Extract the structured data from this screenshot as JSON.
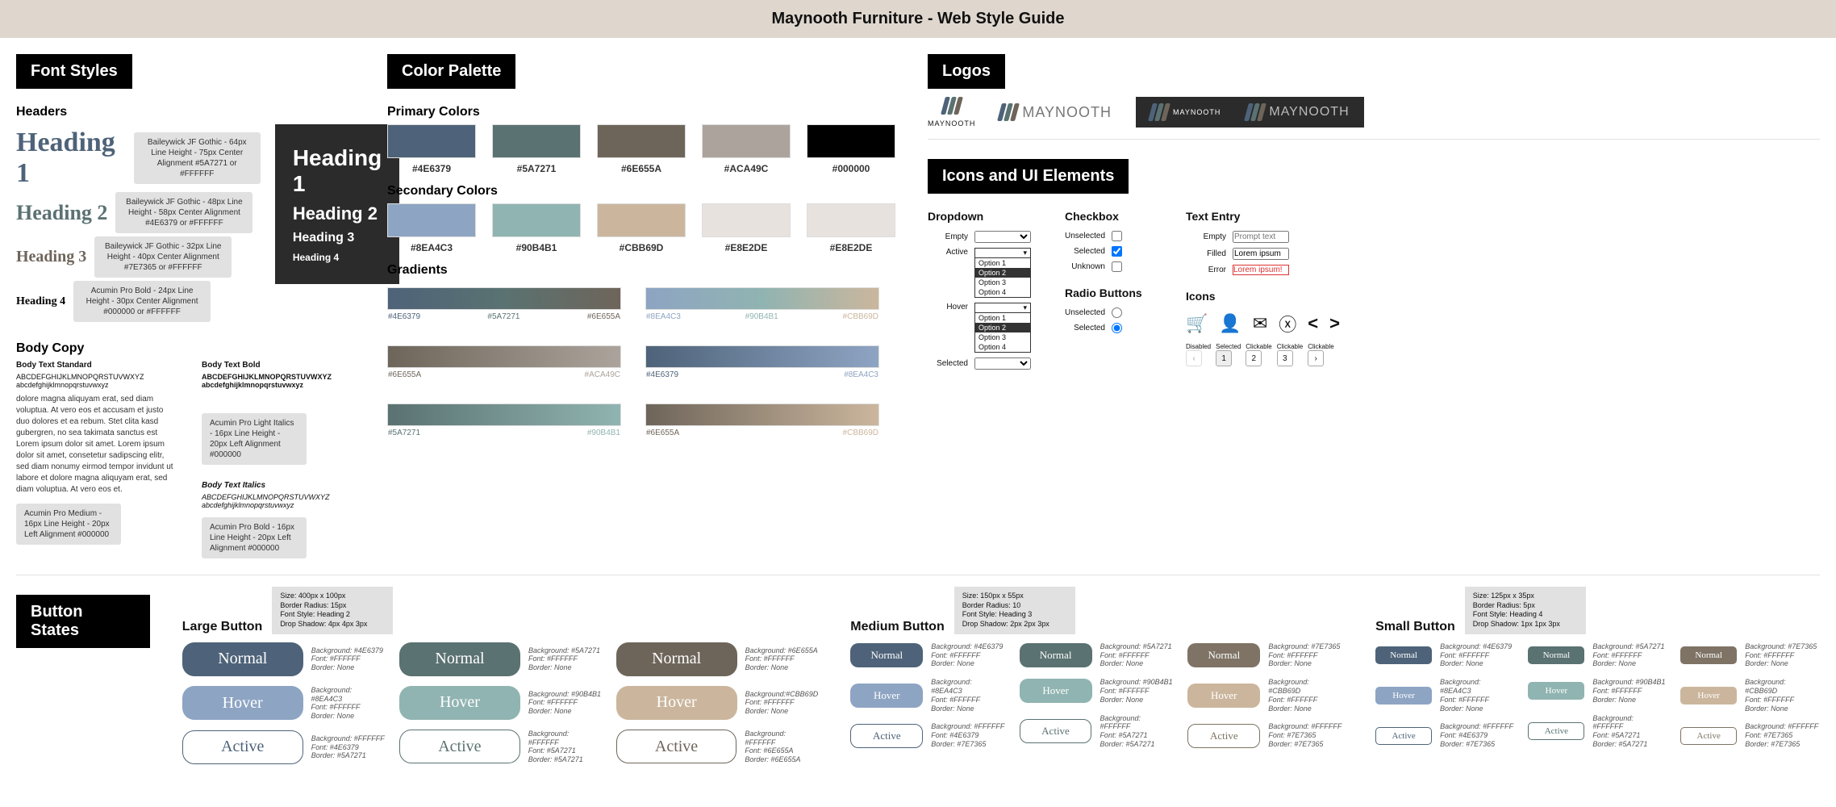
{
  "banner": "Maynooth Furniture - Web Style Guide",
  "sections": {
    "fontStyles": "Font Styles",
    "colorPalette": "Color Palette",
    "logos": "Logos",
    "iconsUI": "Icons and UI Elements",
    "buttonStates": "Button States"
  },
  "fontStyles": {
    "headersLabel": "Headers",
    "bodyCopyLabel": "Body Copy",
    "headings": [
      {
        "label": "Heading 1",
        "annot": "Baileywick JF Gothic - 64px\nLine Height - 75px\nCenter Alignment\n#5A7271 or #FFFFFF"
      },
      {
        "label": "Heading 2",
        "annot": "Baileywick JF Gothic - 48px\nLine Height - 58px\nCenter Alignment\n#4E6379 or #FFFFFF"
      },
      {
        "label": "Heading 3",
        "annot": "Baileywick JF Gothic - 32px\nLine Height - 40px\nCenter Alignment\n#7E7365 or #FFFFFF"
      },
      {
        "label": "Heading 4",
        "annot": "Acumin Pro Bold - 24px\nLine Height - 30px\nCenter Alignment\n#000000 or #FFFFFF"
      }
    ],
    "body": {
      "standardTitle": "Body Text Standard",
      "standardSample": "ABCDEFGHIJKLMNOPQRSTUVWXYZ\nabcdefghijklmnopqrstuvwxyz",
      "lorem": "dolore magna aliquyam erat, sed diam voluptua. At vero eos et accusam et justo duo dolores et ea rebum. Stet clita kasd gubergren, no sea takimata sanctus est Lorem ipsum dolor sit amet. Lorem ipsum dolor sit amet, consetetur sadipscing elitr, sed diam nonumy eirmod tempor invidunt ut labore et dolore magna aliquyam erat, sed diam voluptua. At vero eos et.",
      "standardAnnot": "Acumin Pro Medium - 16px\nLine Height - 20px\nLeft Alignment\n#000000",
      "boldTitle": "Body Text Bold",
      "boldSample": "ABCDEFGHIJKLMNOPQRSTUVWXYZ\nabcdefghijklmnopqrstuvwxyz",
      "boldAnnot": "Acumin Pro Light Italics - 16px\nLine Height - 20px\nLeft Alignment\n#000000",
      "italicTitle": "Body Text Italics",
      "italicSample": "ABCDEFGHIJKLMNOPQRSTUVWXYZ\nabcdefghijklmnopqrstuvwxyz",
      "italicAnnot": "Acumin Pro Bold - 16px\nLine Height - 20px\nLeft Alignment\n#000000"
    }
  },
  "colors": {
    "primaryLabel": "Primary Colors",
    "secondaryLabel": "Secondary Colors",
    "gradientsLabel": "Gradients",
    "primary": [
      {
        "hex": "#4E6379"
      },
      {
        "hex": "#5A7271"
      },
      {
        "hex": "#6E655A"
      },
      {
        "hex": "#ACA49C"
      },
      {
        "hex": "#000000"
      }
    ],
    "secondary": [
      {
        "hex": "#8EA4C3"
      },
      {
        "hex": "#90B4B1"
      },
      {
        "hex": "#CBB69D"
      },
      {
        "hex": "#E8E2DE"
      },
      {
        "hex": "#E8E2DE"
      }
    ],
    "gradients": [
      {
        "stops": [
          "#4E6379",
          "#5A7271",
          "#6E655A"
        ]
      },
      {
        "stops": [
          "#8EA4C3",
          "#90B4B1",
          "#CBB69D"
        ]
      },
      {
        "stops": [
          "#6E655A",
          "#ACA49C"
        ]
      },
      {
        "stops": [
          "#4E6379",
          "#8EA4C3"
        ]
      },
      {
        "stops": [
          "#5A7271",
          "#90B4B1"
        ]
      },
      {
        "stops": [
          "#6E655A",
          "#CBB69D"
        ]
      }
    ]
  },
  "logos": {
    "brand": "MAYNOOTH"
  },
  "iconsUI": {
    "dropdown": {
      "title": "Dropdown",
      "states": [
        "Empty",
        "Active",
        "Hover",
        "Selected"
      ],
      "options": [
        "Option 1",
        "Option 2",
        "Option 3",
        "Option 4"
      ]
    },
    "checkbox": {
      "title": "Checkbox",
      "states": [
        "Unselected",
        "Selected",
        "Unknown"
      ]
    },
    "radio": {
      "title": "Radio Buttons",
      "states": [
        "Unselected",
        "Selected"
      ]
    },
    "textEntry": {
      "title": "Text Entry",
      "states": {
        "empty": {
          "label": "Empty",
          "placeholder": "Prompt text"
        },
        "filled": {
          "label": "Filled",
          "value": "Lorem ipsum"
        },
        "error": {
          "label": "Error",
          "value": "Lorem ipsum!",
          "mark": "!"
        }
      }
    },
    "icons": {
      "title": "Icons",
      "pager": {
        "labels": [
          "Disabled",
          "Selected",
          "Clickable",
          "Clickable",
          "Clickable"
        ],
        "items": [
          "‹",
          "1",
          "2",
          "3",
          "›"
        ]
      }
    }
  },
  "buttons": {
    "sizes": {
      "large": {
        "title": "Large Button",
        "spec": "Size: 400px x 100px\nBorder Radius: 15px\nFont Style: Heading 2\nDrop Shadow: 4px 4px 3px"
      },
      "medium": {
        "title": "Medium Button",
        "spec": "Size: 150px x 55px\nBorder Radius: 10\nFont Style: Heading 3\nDrop Shadow: 2px 2px 3px"
      },
      "small": {
        "title": "Small Button",
        "spec": "Size: 125px x 35px\nBorder Radius: 5px\nFont Style: Heading 4\nDrop Shadow: 1px 1px 3px"
      }
    },
    "labels": {
      "normal": "Normal",
      "hover": "Hover",
      "active": "Active"
    },
    "variants": [
      {
        "normal": {
          "bg": "#4E6379",
          "info": "Background: #4E6379\nFont: #FFFFFF\nBorder: None"
        },
        "hover": {
          "bg": "#8EA4C3",
          "info": "Background: #8EA4C3\nFont: #FFFFFF\nBorder: None"
        },
        "active": {
          "bg": "#FFFFFF",
          "font": "#4E6379",
          "info": "Background: #FFFFFF\nFont: #4E6379\nBorder: #5A7271"
        }
      },
      {
        "normal": {
          "bg": "#5A7271",
          "info": "Background: #5A7271\nFont: #FFFFFF\nBorder: None"
        },
        "hover": {
          "bg": "#90B4B1",
          "info": "Background: #90B4B1\nFont: #FFFFFF\nBorder: None"
        },
        "active": {
          "bg": "#FFFFFF",
          "font": "#5A7271",
          "info": "Background: #FFFFFF\nFont: #5A7271\nBorder: #5A7271"
        }
      },
      {
        "normal": {
          "bg": "#6E655A",
          "info": "Background: #6E655A\nFont: #FFFFFF\nBorder: None"
        },
        "hover": {
          "bg": "#CBB69D",
          "info": "Background:#CBB69D\nFont: #FFFFFF\nBorder: None"
        },
        "active": {
          "bg": "#FFFFFF",
          "font": "#6E655A",
          "info": "Background: #FFFFFF\nFont: #6E655A\nBorder: #6E655A"
        }
      }
    ],
    "mediumVariants": [
      {
        "normal": {
          "bg": "#4E6379",
          "info": "Background: #4E6379\nFont: #FFFFFF\nBorder: None"
        },
        "hover": {
          "bg": "#8EA4C3",
          "info": "Background: #8EA4C3\nFont: #FFFFFF\nBorder: None"
        },
        "active": {
          "bg": "#FFFFFF",
          "font": "#4E6379",
          "info": "Background: #FFFFFF\nFont: #4E6379\nBorder: #7E7365"
        }
      },
      {
        "normal": {
          "bg": "#5A7271",
          "info": "Background: #5A7271\nFont: #FFFFFF\nBorder: None"
        },
        "hover": {
          "bg": "#90B4B1",
          "info": "Background: #90B4B1\nFont: #FFFFFF\nBorder: None"
        },
        "active": {
          "bg": "#FFFFFF",
          "font": "#5A7271",
          "info": "Background: #FFFFFF\nFont: #5A7271\nBorder: #5A7271"
        }
      },
      {
        "normal": {
          "bg": "#7E7365",
          "info": "Background: #7E7365\nFont: #FFFFFF\nBorder: None"
        },
        "hover": {
          "bg": "#CBB69D",
          "info": "Background: #CBB69D\nFont: #FFFFFF\nBorder: None"
        },
        "active": {
          "bg": "#FFFFFF",
          "font": "#7E7365",
          "info": "Background: #FFFFFF\nFont: #7E7365\nBorder: #7E7365"
        }
      }
    ]
  }
}
